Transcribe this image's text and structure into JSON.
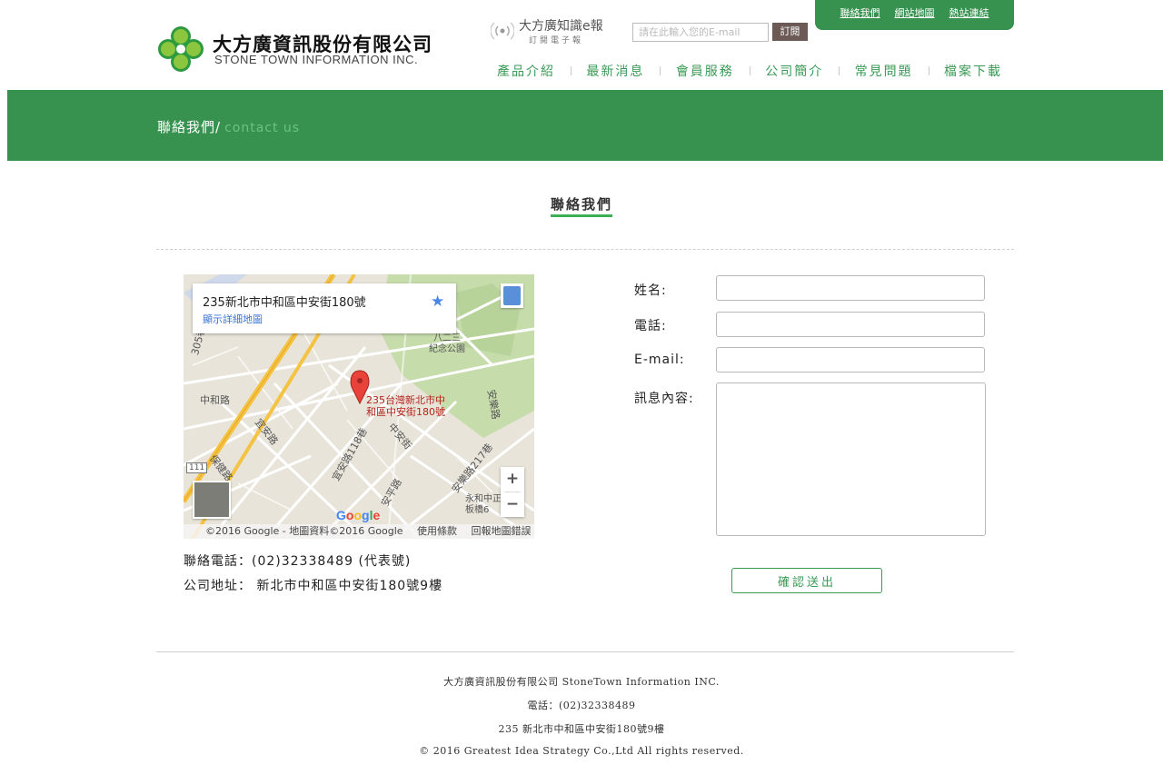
{
  "brand": {
    "name_zh": "大方廣資訊股份有限公司",
    "name_en": "STONE TOWN INFORMATION INC.",
    "logo_color": "#2e9a3f"
  },
  "epaper": {
    "title": "大方廣知識e報",
    "subtitle": "訂閱電子報",
    "input_placeholder": "請在此輸入您的E-mail",
    "subscribe_label": "訂閱"
  },
  "toplinks": [
    "聯絡我們",
    "網站地圖",
    "熱站連結"
  ],
  "nav": [
    "產品介紹",
    "最新消息",
    "會員服務",
    "公司簡介",
    "常見問題",
    "檔案下載"
  ],
  "banner": {
    "title": "聯絡我們/",
    "subtitle": "contact us",
    "color": "#38924f"
  },
  "section_title": "聯絡我們",
  "map": {
    "card_address": "235新北市中和區中安街180號",
    "card_link": "顯示詳細地圖",
    "pin_label_line1": "235台灣新北市中",
    "pin_label_line2": "和區中安街180號",
    "labels": {
      "road_zhonghe": "中和路",
      "road_yian": "宜安路",
      "road_yian118": "宜安路118巷",
      "road_zhongan": "中安街",
      "road_anle217": "安樂路217巷",
      "road_anping": "安平路",
      "road_anle": "安樂路",
      "road_baojian": "保健路",
      "park": "八二三\n紀念公園",
      "route_111": "111",
      "yonghe": "永和中正\n板橋6",
      "road_305": "305巷"
    },
    "zoom_in": "+",
    "zoom_out": "−",
    "google": "Google",
    "footer": [
      "©2016 Google - 地圖資料©2016 Google",
      "使用條款",
      "回報地圖錯誤"
    ]
  },
  "contact": {
    "phone": "聯絡電話：(02)32338489 (代表號)",
    "address": "公司地址： 新北市中和區中安街180號9樓"
  },
  "form": {
    "name_label": "姓名:",
    "phone_label": "電話:",
    "email_label": "E-mail:",
    "message_label": "訊息內容:",
    "submit_label": "確認送出"
  },
  "footer": {
    "company": "大方廣資訊股份有限公司   StoneTown Information INC.",
    "phone": "電話：(02)32338489",
    "address": "235 新北市中和區中安街180號9樓",
    "copyright": "© 2016 Greatest Idea Strategy Co.,Ltd All rights reserved."
  }
}
